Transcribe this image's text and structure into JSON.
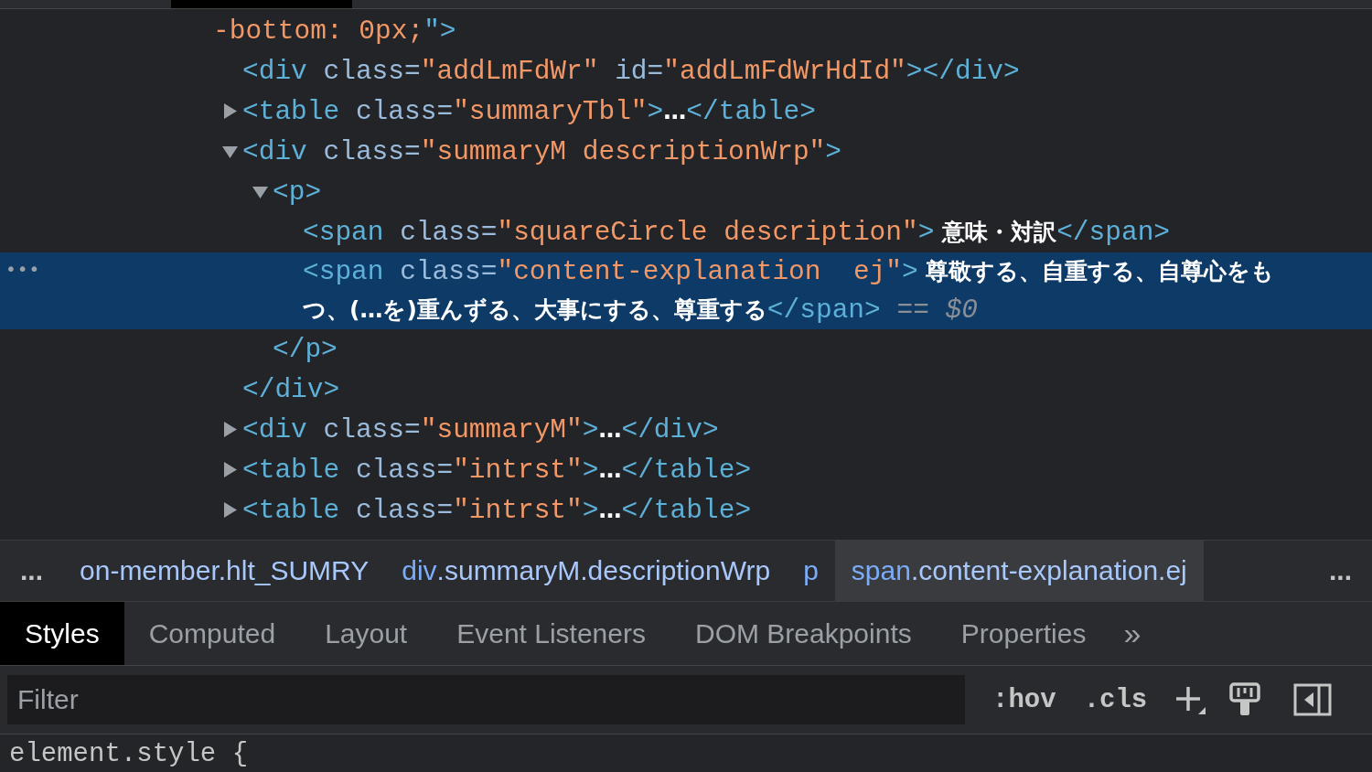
{
  "dom_tree": {
    "nodes": [
      {
        "kind": "tail",
        "selected": false,
        "tokens": [
          {
            "kind": "value",
            "s": "-bottom: 0px;"
          },
          {
            "kind": "tag",
            "s": "\">"
          }
        ]
      },
      {
        "kind": "element",
        "selected": false,
        "tokens": [
          {
            "kind": "tag",
            "s": "<div "
          },
          {
            "kind": "attr",
            "s": "class="
          },
          {
            "kind": "value",
            "s": "\"addLmFdWr\""
          },
          {
            "kind": "attr",
            "s": " id="
          },
          {
            "kind": "value",
            "s": "\"addLmFdWrHdId\""
          },
          {
            "kind": "tag",
            "s": "></div>"
          }
        ]
      },
      {
        "kind": "element",
        "selected": false,
        "expanded": false,
        "tokens": [
          {
            "kind": "tag",
            "s": "<table "
          },
          {
            "kind": "attr",
            "s": "class="
          },
          {
            "kind": "value",
            "s": "\"summaryTbl\""
          },
          {
            "kind": "tag",
            "s": ">"
          },
          {
            "kind": "text",
            "s": "…"
          },
          {
            "kind": "tag",
            "s": "</table>"
          }
        ]
      },
      {
        "kind": "element",
        "selected": false,
        "expanded": true,
        "tokens": [
          {
            "kind": "tag",
            "s": "<div "
          },
          {
            "kind": "attr",
            "s": "class="
          },
          {
            "kind": "value",
            "s": "\"summaryM descriptionWrp\""
          },
          {
            "kind": "tag",
            "s": ">"
          }
        ],
        "close": [
          {
            "kind": "tag",
            "s": "</div>"
          }
        ],
        "children": [
          {
            "kind": "element",
            "selected": false,
            "expanded": true,
            "tokens": [
              {
                "kind": "tag",
                "s": "<p>"
              }
            ],
            "close": [
              {
                "kind": "tag",
                "s": "</p>"
              }
            ],
            "children": [
              {
                "kind": "element",
                "selected": false,
                "tokens": [
                  {
                    "kind": "tag",
                    "s": "<span "
                  },
                  {
                    "kind": "attr",
                    "s": "class="
                  },
                  {
                    "kind": "value",
                    "s": "\"squareCircle description\""
                  },
                  {
                    "kind": "tag",
                    "s": ">"
                  },
                  {
                    "kind": "text",
                    "s": " 意味・対訳"
                  },
                  {
                    "kind": "tag",
                    "s": "</span>"
                  }
                ]
              },
              {
                "kind": "element",
                "selected": true,
                "tokens": [
                  {
                    "kind": "tag",
                    "s": "<span "
                  },
                  {
                    "kind": "attr",
                    "s": "class="
                  },
                  {
                    "kind": "value",
                    "s": "\"content-explanation  ej\""
                  },
                  {
                    "kind": "tag",
                    "s": ">"
                  },
                  {
                    "kind": "text",
                    "s": " 尊敬する、自重する、自尊心をもつ、(…を)重んずる、大事にする、尊重する"
                  },
                  {
                    "kind": "tag",
                    "s": "</span>"
                  },
                  {
                    "kind": "dim",
                    "s": " == $0"
                  }
                ]
              }
            ]
          }
        ]
      },
      {
        "kind": "element",
        "selected": false,
        "expanded": false,
        "tokens": [
          {
            "kind": "tag",
            "s": "<div "
          },
          {
            "kind": "attr",
            "s": "class="
          },
          {
            "kind": "value",
            "s": "\"summaryM\""
          },
          {
            "kind": "tag",
            "s": ">"
          },
          {
            "kind": "text",
            "s": "…"
          },
          {
            "kind": "tag",
            "s": "</div>"
          }
        ]
      },
      {
        "kind": "element",
        "selected": false,
        "expanded": false,
        "tokens": [
          {
            "kind": "tag",
            "s": "<table "
          },
          {
            "kind": "attr",
            "s": "class="
          },
          {
            "kind": "value",
            "s": "\"intrst\""
          },
          {
            "kind": "tag",
            "s": ">"
          },
          {
            "kind": "text",
            "s": "…"
          },
          {
            "kind": "tag",
            "s": "</table>"
          }
        ]
      },
      {
        "kind": "element",
        "selected": false,
        "expanded": false,
        "tokens": [
          {
            "kind": "tag",
            "s": "<table "
          },
          {
            "kind": "attr",
            "s": "class="
          },
          {
            "kind": "value",
            "s": "\"intrst\""
          },
          {
            "kind": "tag",
            "s": ">"
          },
          {
            "kind": "text",
            "s": "…"
          },
          {
            "kind": "tag",
            "s": "</table>"
          }
        ]
      }
    ],
    "selected_row_marker": "•••"
  },
  "breadcrumbs": {
    "more_left": "...",
    "more_right": "...",
    "items": [
      {
        "selected": false,
        "parts": [
          {
            "kind": "cls",
            "s": "on-member.hlt_SUMRY"
          }
        ]
      },
      {
        "selected": false,
        "parts": [
          {
            "kind": "tag",
            "s": "div"
          },
          {
            "kind": "cls",
            "s": ".summaryM.descriptionWrp"
          }
        ]
      },
      {
        "selected": false,
        "parts": [
          {
            "kind": "tag",
            "s": "p"
          }
        ]
      },
      {
        "selected": true,
        "parts": [
          {
            "kind": "tag",
            "s": "span"
          },
          {
            "kind": "cls",
            "s": ".content-explanation.ej"
          }
        ]
      }
    ]
  },
  "tabs": [
    {
      "label": "Styles",
      "selected": true
    },
    {
      "label": "Computed",
      "selected": false
    },
    {
      "label": "Layout",
      "selected": false
    },
    {
      "label": "Event Listeners",
      "selected": false
    },
    {
      "label": "DOM Breakpoints",
      "selected": false
    },
    {
      "label": "Properties",
      "selected": false
    }
  ],
  "tabs_overflow": "»",
  "filter": {
    "placeholder": "Filter",
    "hov": ":hov",
    "cls": ".cls"
  },
  "styles_pane": {
    "first_rule": "element.style {"
  }
}
